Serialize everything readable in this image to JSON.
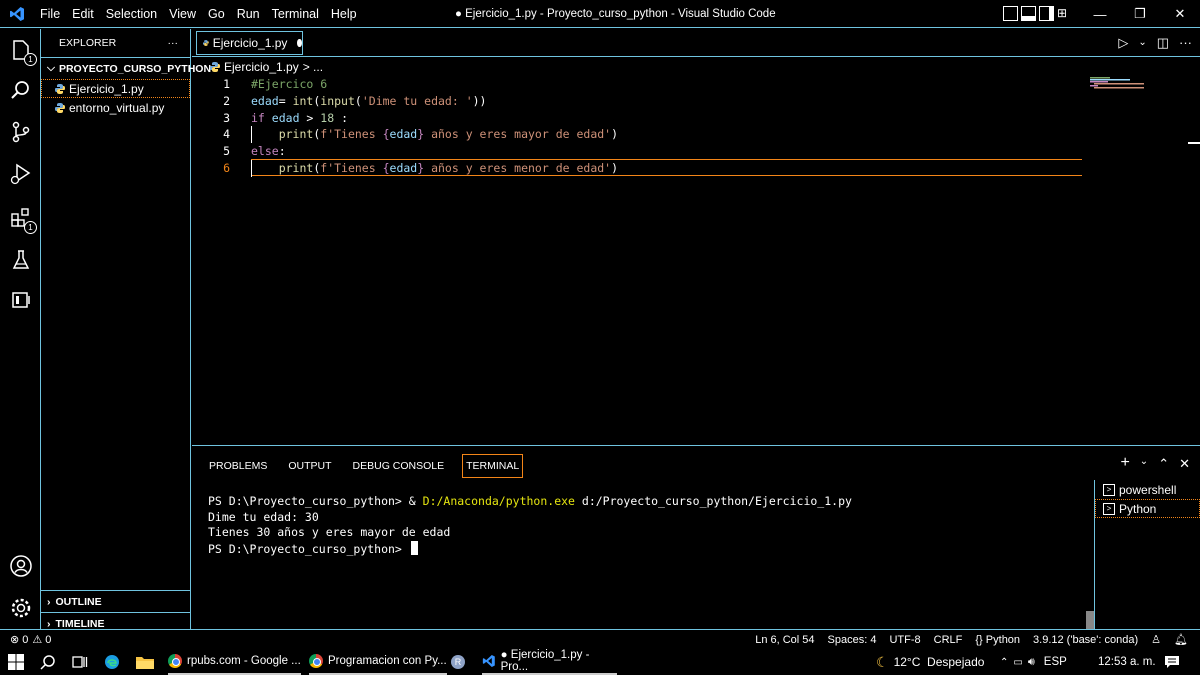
{
  "titlebar": {
    "menu": [
      "File",
      "Edit",
      "Selection",
      "View",
      "Go",
      "Run",
      "Terminal",
      "Help"
    ],
    "title": "● Ejercicio_1.py - Proyecto_curso_python - Visual Studio Code"
  },
  "activity": {
    "badges": {
      "explorer": "1",
      "extensions": "1"
    }
  },
  "sidebar": {
    "header": "EXPLORER",
    "more": "···",
    "project": "PROYECTO_CURSO_PYTHON",
    "files": [
      "Ejercicio_1.py",
      "entorno_virtual.py"
    ],
    "outline": "OUTLINE",
    "timeline": "TIMELINE"
  },
  "editor": {
    "tab_label": "Ejercicio_1.py",
    "breadcrumb_file": "Ejercicio_1.py",
    "breadcrumb_rest": "> ...",
    "line_numbers": [
      "1",
      "2",
      "3",
      "4",
      "5",
      "6"
    ]
  },
  "panel": {
    "tabs": [
      "PROBLEMS",
      "OUTPUT",
      "DEBUG CONSOLE",
      "TERMINAL"
    ],
    "terminal": {
      "line1_prompt": "PS D:\\Proyecto_curso_python> & ",
      "line1_exe": "D:/Anaconda/python.exe",
      "line1_arg": " d:/Proyecto_curso_python/Ejercicio_1.py",
      "line2": "Dime tu edad: 30",
      "line3": "Tienes 30 años y eres mayor de edad",
      "line4": "PS D:\\Proyecto_curso_python> "
    },
    "terminals": [
      "powershell",
      "Python"
    ]
  },
  "statusbar": {
    "errors": "⊗ 0",
    "warnings": "⚠ 0",
    "position": "Ln 6, Col 54",
    "spaces": "Spaces: 4",
    "encoding": "UTF-8",
    "eol": "CRLF",
    "language": "Python",
    "interpreter": "3.9.12 ('base': conda)"
  },
  "taskbar": {
    "chrome1": "rpubs.com - Google ...",
    "chrome2": "Programacion con Py...",
    "vscode": "● Ejercicio_1.py - Pro...",
    "weather": "12°C  Despejado",
    "lang": "ESP",
    "time": "12:53 a. m."
  },
  "colors": {
    "border": "#6fc3df",
    "focus": "#f38518",
    "comment": "#7ca668",
    "keyword": "#c586c0",
    "variable": "#9cdcfe",
    "function": "#dcdcaa",
    "string": "#ce9178"
  }
}
